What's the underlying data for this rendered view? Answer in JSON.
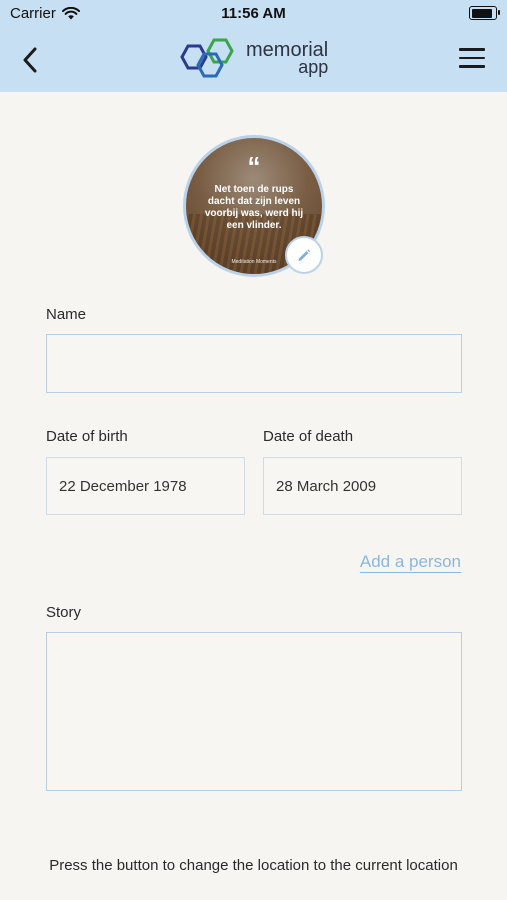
{
  "status_bar": {
    "carrier": "Carrier",
    "time": "11:56 AM",
    "wifi_icon": "wifi-icon",
    "battery_icon": "battery-icon"
  },
  "navbar": {
    "background": "#c7dff2",
    "back_icon": "chevron-left-icon",
    "menu_icon": "hamburger-menu-icon",
    "logo": {
      "line1": "memorial",
      "line2": "app",
      "colors": [
        "#2b3a8c",
        "#2b6bb5",
        "#3aa54a"
      ]
    }
  },
  "avatar": {
    "quote_mark": "“",
    "quote": "Net toen de rups dacht dat zijn leven voorbij was, werd hij een vlinder.",
    "credit": "Meditation Moments",
    "edit_icon": "pencil-icon"
  },
  "form": {
    "name_label": "Name",
    "name_value": "",
    "birth_label": "Date of birth",
    "birth_value": "22 December 1978",
    "death_label": "Date of death",
    "death_value": "28 March 2009",
    "add_person": "Add a person",
    "story_label": "Story",
    "story_value": ""
  },
  "footer": {
    "location_text": "Press the button to change the location to the current location"
  },
  "colors": {
    "accent": "#8ab8de",
    "field_border": "#b6cfe6",
    "background": "#f6f5f2"
  }
}
